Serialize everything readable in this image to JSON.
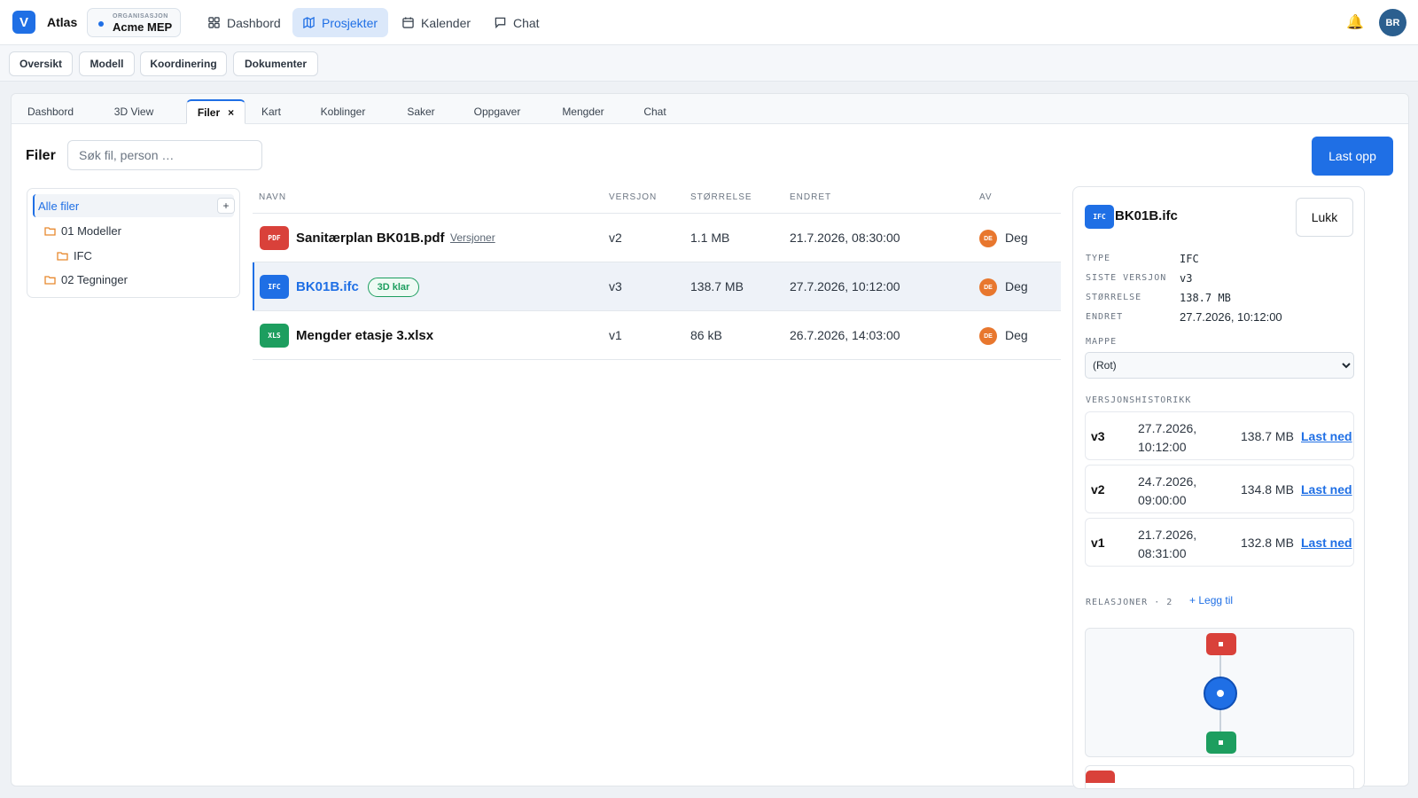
{
  "app": {
    "logo_letter": "V",
    "name": "Atlas"
  },
  "org": {
    "label": "ORGANISASJON",
    "name": "Acme MEP"
  },
  "nav": [
    {
      "label": "Dashbord",
      "icon": "grid-icon"
    },
    {
      "label": "Prosjekter",
      "icon": "map-icon",
      "active": true
    },
    {
      "label": "Kalender",
      "icon": "calendar-icon"
    },
    {
      "label": "Chat",
      "icon": "chat-icon"
    }
  ],
  "user": {
    "initials": "BR"
  },
  "subtabs": [
    "Oversikt",
    "Modell",
    "Koordinering",
    "Dokumenter"
  ],
  "workspace_tabs": [
    {
      "label": "Dashbord"
    },
    {
      "label": "3D View"
    },
    {
      "label": "Filer",
      "active": true,
      "close": "×"
    },
    {
      "label": "Kart"
    },
    {
      "label": "Koblinger"
    },
    {
      "label": "Saker"
    },
    {
      "label": "Oppgaver"
    },
    {
      "label": "Mengder"
    },
    {
      "label": "Chat"
    }
  ],
  "files": {
    "title": "Filer",
    "search_placeholder": "Søk fil, person …",
    "upload_label": "Last opp",
    "tree": {
      "all_label": "Alle filer",
      "add": "+",
      "folders": [
        "01 Modeller",
        "IFC",
        "02 Tegninger"
      ]
    },
    "columns": {
      "name": "NAVN",
      "version": "VERSJON",
      "size": "STØRRELSE",
      "modified": "ENDRET",
      "by": "AV"
    },
    "rows": [
      {
        "type": "PDF",
        "type_color": "#d9413a",
        "name": "Sanitærplan BK01B.pdf",
        "link": "Versjoner",
        "version": "v2",
        "size": "1.1 MB",
        "modified": "21.7.2026, 08:30:00",
        "by_initials": "DE",
        "by": "Deg"
      },
      {
        "type": "IFC",
        "type_color": "#1f6fe5",
        "name": "BK01B.ifc",
        "badge": "3D klar",
        "version": "v3",
        "size": "138.7 MB",
        "modified": "27.7.2026, 10:12:00",
        "by_initials": "DE",
        "by": "Deg",
        "selected": true
      },
      {
        "type": "XLS",
        "type_color": "#1d9e5f",
        "name": "Mengder etasje 3.xlsx",
        "version": "v1",
        "size": "86 kB",
        "modified": "26.7.2026, 14:03:00",
        "by_initials": "DE",
        "by": "Deg"
      }
    ]
  },
  "details": {
    "icon": "IFC",
    "title": "BK01B.ifc",
    "close_label": "Lukk",
    "meta": [
      {
        "label": "TYPE",
        "value": "IFC"
      },
      {
        "label": "SISTE VERSJON",
        "value": "v3"
      },
      {
        "label": "STØRRELSE",
        "value": "138.7 MB"
      },
      {
        "label": "ENDRET",
        "value": "27.7.2026, 10:12:00"
      }
    ],
    "folder_label": "MAPPE",
    "folder_value": "(Rot)",
    "history_label": "VERSJONSHISTORIKK",
    "history": [
      {
        "version": "v3",
        "date": "27.7.2026, 10:12:00",
        "size": "138.7 MB",
        "download": "Last ned"
      },
      {
        "version": "v2",
        "date": "24.7.2026, 09:00:00",
        "size": "134.8 MB",
        "download": "Last ned"
      },
      {
        "version": "v1",
        "date": "21.7.2026, 08:31:00",
        "size": "132.8 MB",
        "download": "Last ned"
      }
    ],
    "relations_label": "RELASJONER · 2",
    "relations_add": "+ Legg til",
    "graph_colors": {
      "top": "#d9413a",
      "center": "#1f6fe5",
      "bottom": "#1d9e5f"
    }
  }
}
